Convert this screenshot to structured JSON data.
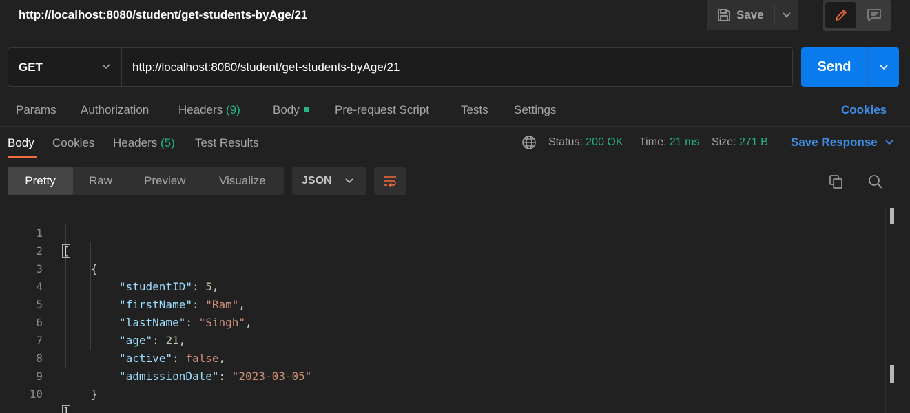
{
  "request": {
    "title": "http://localhost:8080/student/get-students-byAge/21",
    "method": "GET",
    "url": "http://localhost:8080/student/get-students-byAge/21"
  },
  "toolbar": {
    "save_label": "Save",
    "send_label": "Send"
  },
  "request_tabs": {
    "params": "Params",
    "authorization": "Authorization",
    "headers": "Headers",
    "headers_count": "(9)",
    "body": "Body",
    "pre_request": "Pre-request Script",
    "tests": "Tests",
    "settings": "Settings",
    "cookies": "Cookies"
  },
  "response_tabs": {
    "body": "Body",
    "cookies": "Cookies",
    "headers": "Headers",
    "headers_count": "(5)",
    "test_results": "Test Results"
  },
  "response_meta": {
    "status_label": "Status:",
    "status_value": "200 OK",
    "time_label": "Time:",
    "time_value": "21 ms",
    "size_label": "Size:",
    "size_value": "271 B",
    "save_response": "Save Response"
  },
  "view": {
    "modes": [
      "Pretty",
      "Raw",
      "Preview",
      "Visualize"
    ],
    "format": "JSON"
  },
  "response_body": {
    "lines": [
      "1",
      "2",
      "3",
      "4",
      "5",
      "6",
      "7",
      "8",
      "9",
      "10"
    ],
    "open_bracket": "[",
    "close_bracket": "]",
    "open_brace": "{",
    "close_brace": "}",
    "fields": [
      {
        "key": "\"studentID\"",
        "value": "5",
        "kind": "number"
      },
      {
        "key": "\"firstName\"",
        "value": "\"Ram\"",
        "kind": "string"
      },
      {
        "key": "\"lastName\"",
        "value": "\"Singh\"",
        "kind": "string"
      },
      {
        "key": "\"age\"",
        "value": "21",
        "kind": "number"
      },
      {
        "key": "\"active\"",
        "value": "false",
        "kind": "bool"
      },
      {
        "key": "\"admissionDate\"",
        "value": "\"2023-03-05\"",
        "kind": "string"
      }
    ]
  },
  "colors": {
    "accent": "#097bed",
    "success": "#26b47f",
    "link": "#3d8fe8",
    "active_tab": "#f26b3a",
    "json_key": "#9cdcfe",
    "json_string": "#ce9178",
    "json_number": "#b5cea8"
  },
  "icons": [
    "save-icon",
    "chevron-down-icon",
    "pencil-icon",
    "comment-icon",
    "globe-icon",
    "wrap-lines-icon",
    "copy-icon",
    "search-icon"
  ]
}
